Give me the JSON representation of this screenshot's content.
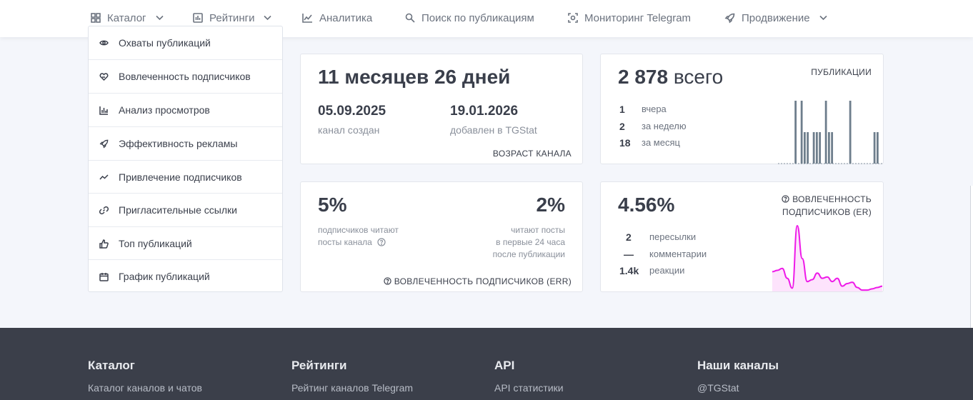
{
  "nav": {
    "items": [
      {
        "label": "Каталог",
        "icon": "grid-icon",
        "dropdown": true
      },
      {
        "label": "Рейтинги",
        "icon": "bar-chart-icon",
        "dropdown": true
      },
      {
        "label": "Аналитика",
        "icon": "line-chart-icon",
        "dropdown": false
      },
      {
        "label": "Поиск по публикациям",
        "icon": "search-icon",
        "dropdown": false
      },
      {
        "label": "Мониторинг Telegram",
        "icon": "scan-icon",
        "dropdown": false
      },
      {
        "label": "Продвижение",
        "icon": "rocket-icon",
        "dropdown": true
      }
    ]
  },
  "sidebar": {
    "items": [
      {
        "label": "Охваты публикаций",
        "icon": "eye-icon"
      },
      {
        "label": "Вовлеченность подписчиков",
        "icon": "heart-hand-icon"
      },
      {
        "label": "Анализ просмотров",
        "icon": "bar-chart-icon"
      },
      {
        "label": "Эффективность рекламы",
        "icon": "rocket-icon"
      },
      {
        "label": "Привлечение подписчиков",
        "icon": "trend-icon"
      },
      {
        "label": "Пригласительные ссылки",
        "icon": "link-icon"
      },
      {
        "label": "Топ публикаций",
        "icon": "thumb-up-icon"
      },
      {
        "label": "График публикаций",
        "icon": "calendar-icon"
      }
    ]
  },
  "age_card": {
    "value": "11 месяцев 26 дней",
    "created_date": "05.09.2025",
    "created_label": "канал создан",
    "added_date": "19.01.2026",
    "added_label": "добавлен в TGStat",
    "caption": "ВОЗРАСТ КАНАЛА"
  },
  "posts_card": {
    "value": "2 878",
    "value_suffix": "всего",
    "caption": "ПУБЛИКАЦИИ",
    "stats": [
      {
        "num": "1",
        "label": "вчера"
      },
      {
        "num": "2",
        "label": "за неделю"
      },
      {
        "num": "18",
        "label": "за месяц"
      }
    ],
    "bars": [
      0,
      0,
      0,
      0,
      0,
      1,
      0,
      1,
      0.5,
      0.5,
      0,
      0.5,
      0.5,
      0.5,
      0,
      1,
      0.5,
      0.5,
      0,
      0,
      0,
      0,
      0,
      1,
      0,
      0,
      0,
      0,
      0,
      0,
      0,
      0.5,
      0.5
    ]
  },
  "err_card": {
    "left_value": "5%",
    "left_label_1": "подписчиков читают",
    "left_label_2": "посты канала",
    "right_value": "2%",
    "right_label_1": "читают посты",
    "right_label_2": "в первые 24 часа",
    "right_label_3": "после публикации",
    "caption": "ВОВЛЕЧЕННОСТЬ ПОДПИСЧИКОВ (ERR)"
  },
  "er_card": {
    "value": "4.56%",
    "caption_1": "ВОВЛЕЧЕННОСТЬ",
    "caption_2": "ПОДПИСЧИКОВ (ER)",
    "stats": [
      {
        "num": "2",
        "label": "пересылки"
      },
      {
        "num": "—",
        "label": "комментарии"
      },
      {
        "num": "1.4k",
        "label": "реакции"
      }
    ],
    "sparkline": [
      0.3,
      0.32,
      0.35,
      0.2,
      0.05,
      1.0,
      0.5,
      0.15,
      0.18,
      0.28,
      0.2,
      0.22,
      0.15,
      0.2,
      0.08,
      0.12,
      0.14,
      0.06,
      0.02,
      0.02,
      0.04,
      0.06,
      0.08
    ],
    "accent": "#ee19e8"
  },
  "footer": {
    "columns": [
      {
        "title": "Каталог",
        "link": "Каталог каналов и чатов"
      },
      {
        "title": "Рейтинги",
        "link": "Рейтинг каналов Telegram"
      },
      {
        "title": "API",
        "link": "API статистики"
      },
      {
        "title": "Наши каналы",
        "link": "@TGStat"
      }
    ]
  }
}
